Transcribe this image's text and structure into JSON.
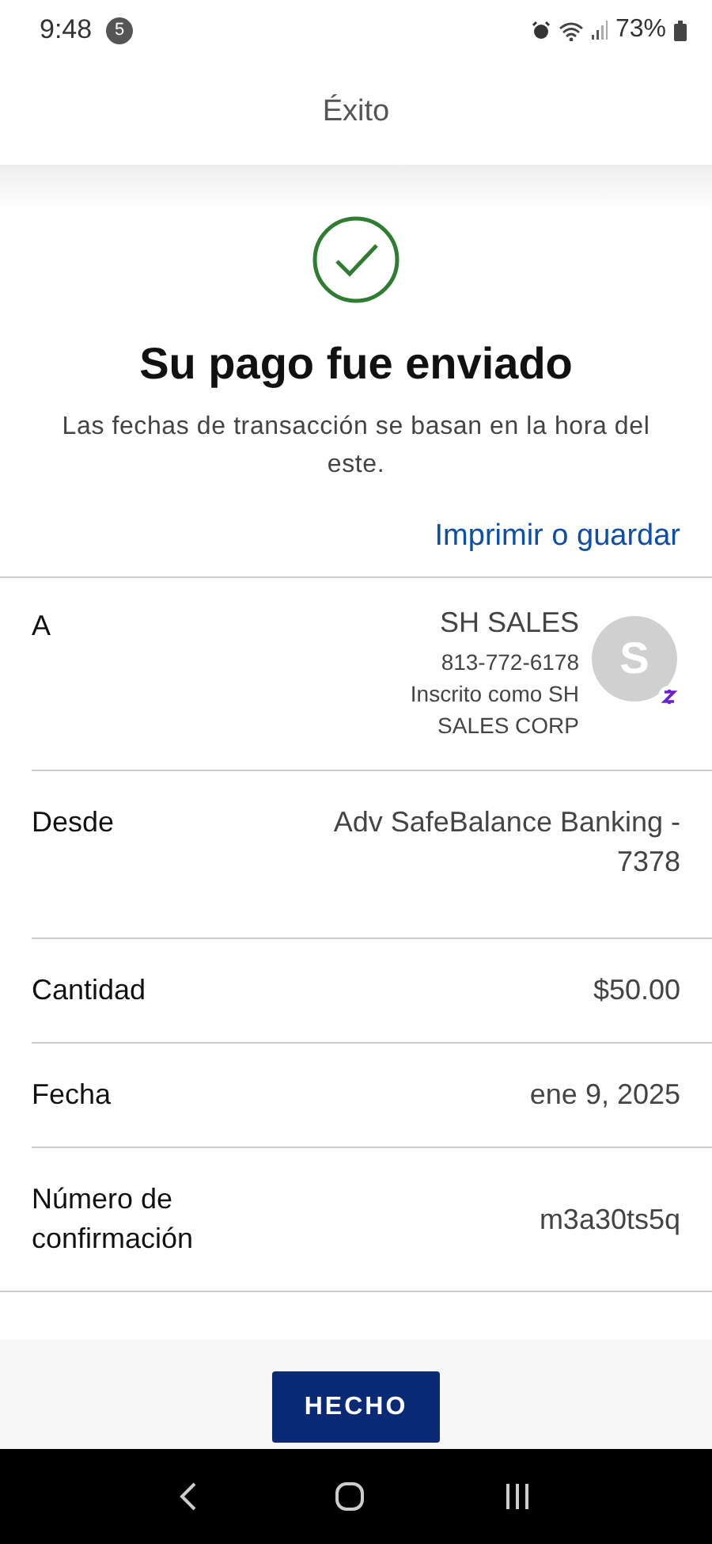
{
  "status_bar": {
    "time": "9:48",
    "notification_count": "5",
    "battery": "73%"
  },
  "header": {
    "title": "Éxito"
  },
  "message": {
    "title": "Su pago fue enviado",
    "subtitle": "Las fechas de transacción se basan en la hora del este."
  },
  "print_link": "Imprimir o guardar",
  "details": [
    {
      "kind": "recipient",
      "label": "A",
      "name": "SH SALES",
      "phone": "813-772-6178",
      "enrolled": "Inscrito como SH SALES CORP",
      "avatar_initial": "S"
    },
    {
      "kind": "text",
      "label": "Desde",
      "value": "Adv SafeBalance Banking - 7378"
    },
    {
      "kind": "text",
      "label": "Cantidad",
      "value": "$50.00"
    },
    {
      "kind": "text",
      "label": "Fecha",
      "value": "ene 9, 2025"
    },
    {
      "kind": "text",
      "label": "Número de confirmación",
      "value": "m3a30ts5q"
    }
  ],
  "done_button": "HECHO"
}
